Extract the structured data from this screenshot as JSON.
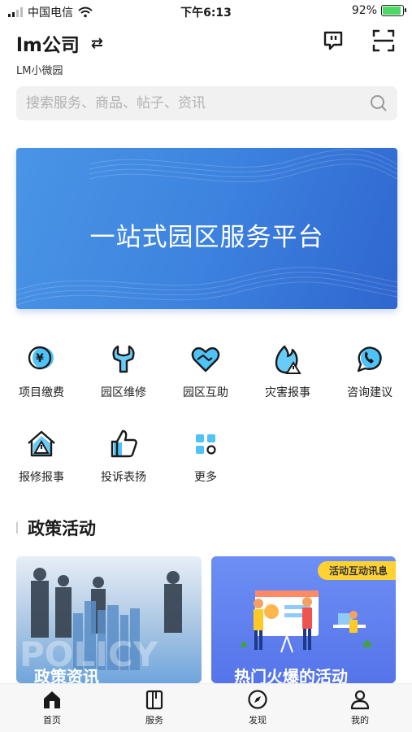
{
  "status_bar": {
    "carrier": "中国电信",
    "time": "下午6:13",
    "battery_percent": "92%",
    "battery_level": 0.92
  },
  "header": {
    "company_name": "lm公司",
    "switch_icon": "swap-arrows-icon",
    "sub_name": "LM小微园",
    "chat_icon": "message-alert-icon",
    "scan_icon": "scan-icon"
  },
  "search": {
    "placeholder": "搜索服务、商品、帖子、资讯",
    "value": ""
  },
  "banner": {
    "title": "一站式园区服务平台"
  },
  "services": [
    {
      "label": "项目缴费",
      "icon": "yen-coin-icon"
    },
    {
      "label": "园区维修",
      "icon": "wrench-icon"
    },
    {
      "label": "园区互助",
      "icon": "heart-hands-icon"
    },
    {
      "label": "灾害报事",
      "icon": "fire-alert-icon"
    },
    {
      "label": "咨询建议",
      "icon": "chat-phone-icon"
    },
    {
      "label": "报修报事",
      "icon": "house-alert-icon"
    },
    {
      "label": "投诉表扬",
      "icon": "thumbs-up-icon"
    },
    {
      "label": "更多",
      "icon": "grid-more-icon"
    }
  ],
  "section": {
    "title": "政策活动"
  },
  "cards": [
    {
      "title": "政策资讯",
      "overlay_text": "POLICY",
      "tag": ""
    },
    {
      "title": "热门火爆的活动",
      "tag": "活动互动讯息"
    }
  ],
  "tabbar": [
    {
      "label": "首页",
      "icon": "home-icon",
      "active": true
    },
    {
      "label": "服务",
      "icon": "book-icon",
      "active": false
    },
    {
      "label": "发现",
      "icon": "compass-icon",
      "active": false
    },
    {
      "label": "我的",
      "icon": "user-icon",
      "active": false
    }
  ],
  "colors": {
    "accent_blue": "#3d83df",
    "icon_cyan": "#4fc3f7",
    "tag_yellow": "#ffd233"
  }
}
